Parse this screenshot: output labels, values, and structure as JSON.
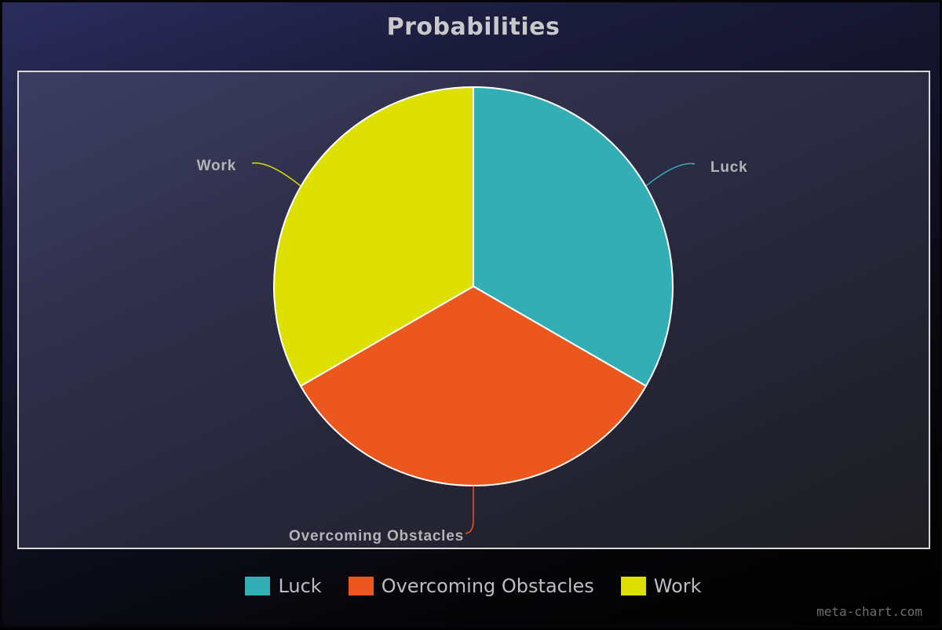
{
  "title": "Probabilities",
  "watermark": "meta-chart.com",
  "chart_data": {
    "type": "pie",
    "title": "Probabilities",
    "slices": [
      {
        "label": "Luck",
        "value": 33.33,
        "color": "#33aeb5"
      },
      {
        "label": "Overcoming Obstacles",
        "value": 33.33,
        "color": "#eb571c"
      },
      {
        "label": "Work",
        "value": 33.33,
        "color": "#dde000"
      }
    ],
    "legend_placement": "bottom",
    "slice_border_color": "#ffffff"
  },
  "legend": {
    "items": [
      {
        "label": "Luck",
        "color": "#33aeb5"
      },
      {
        "label": "Overcoming Obstacles",
        "color": "#eb571c"
      },
      {
        "label": "Work",
        "color": "#dde000"
      }
    ]
  }
}
